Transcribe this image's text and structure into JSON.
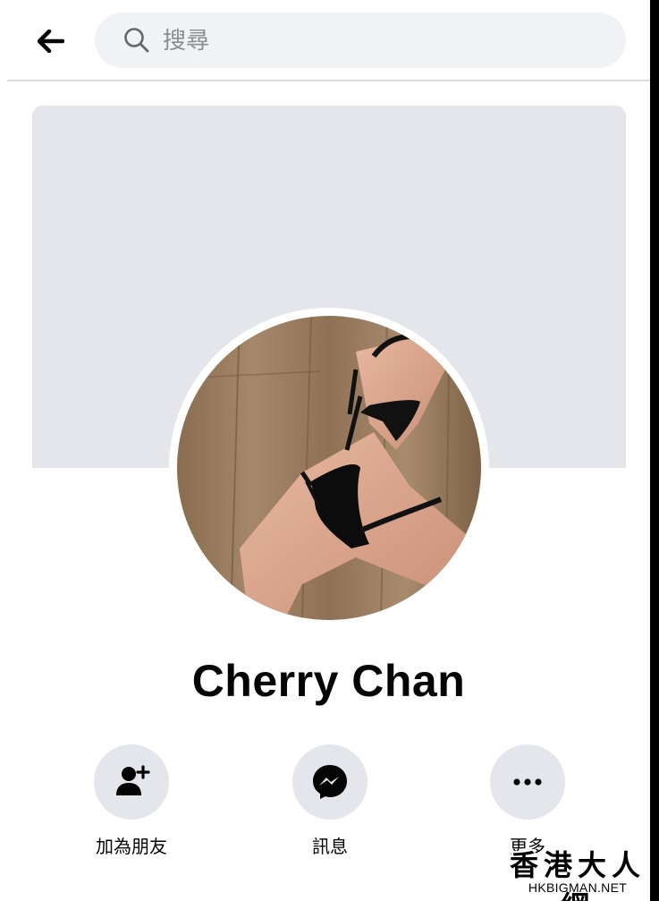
{
  "header": {
    "back_icon": "arrow-left-icon",
    "search": {
      "placeholder": "搜尋",
      "icon": "search-icon"
    }
  },
  "profile": {
    "name": "Cherry Chan",
    "photo_icon": "profile-photo"
  },
  "actions": [
    {
      "label": "加為朋友",
      "icon": "add-friend-icon"
    },
    {
      "label": "訊息",
      "icon": "messenger-icon"
    },
    {
      "label": "更多",
      "icon": "more-icon"
    }
  ],
  "watermark": {
    "title": "香港大人網",
    "site": "HKBIGMAN.NET"
  },
  "colors": {
    "surface": "#f0f2f5",
    "cover": "#e4e6eb",
    "button_bg": "#e4e6eb",
    "text": "#050505",
    "placeholder": "#8a8d91"
  }
}
